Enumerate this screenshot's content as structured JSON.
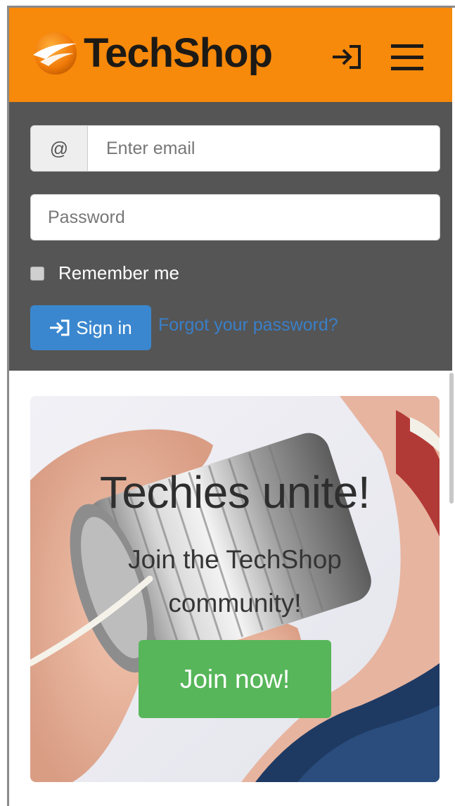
{
  "header": {
    "brand_name": "TechShop",
    "signin_icon": "sign-in-icon",
    "menu_icon": "hamburger-menu-icon",
    "background_color": "#f7890b"
  },
  "login": {
    "email_addon": "@",
    "email_placeholder": "Enter email",
    "password_placeholder": "Password",
    "remember_label": "Remember me",
    "signin_label": "Sign in",
    "forgot_label": "Forgot your password?",
    "panel_color": "#555555",
    "button_color": "#3a87cf"
  },
  "hero": {
    "title": "Techies unite!",
    "subtitle": "Join the TechShop community!",
    "join_label": "Join now!",
    "join_color": "#57b65a"
  }
}
